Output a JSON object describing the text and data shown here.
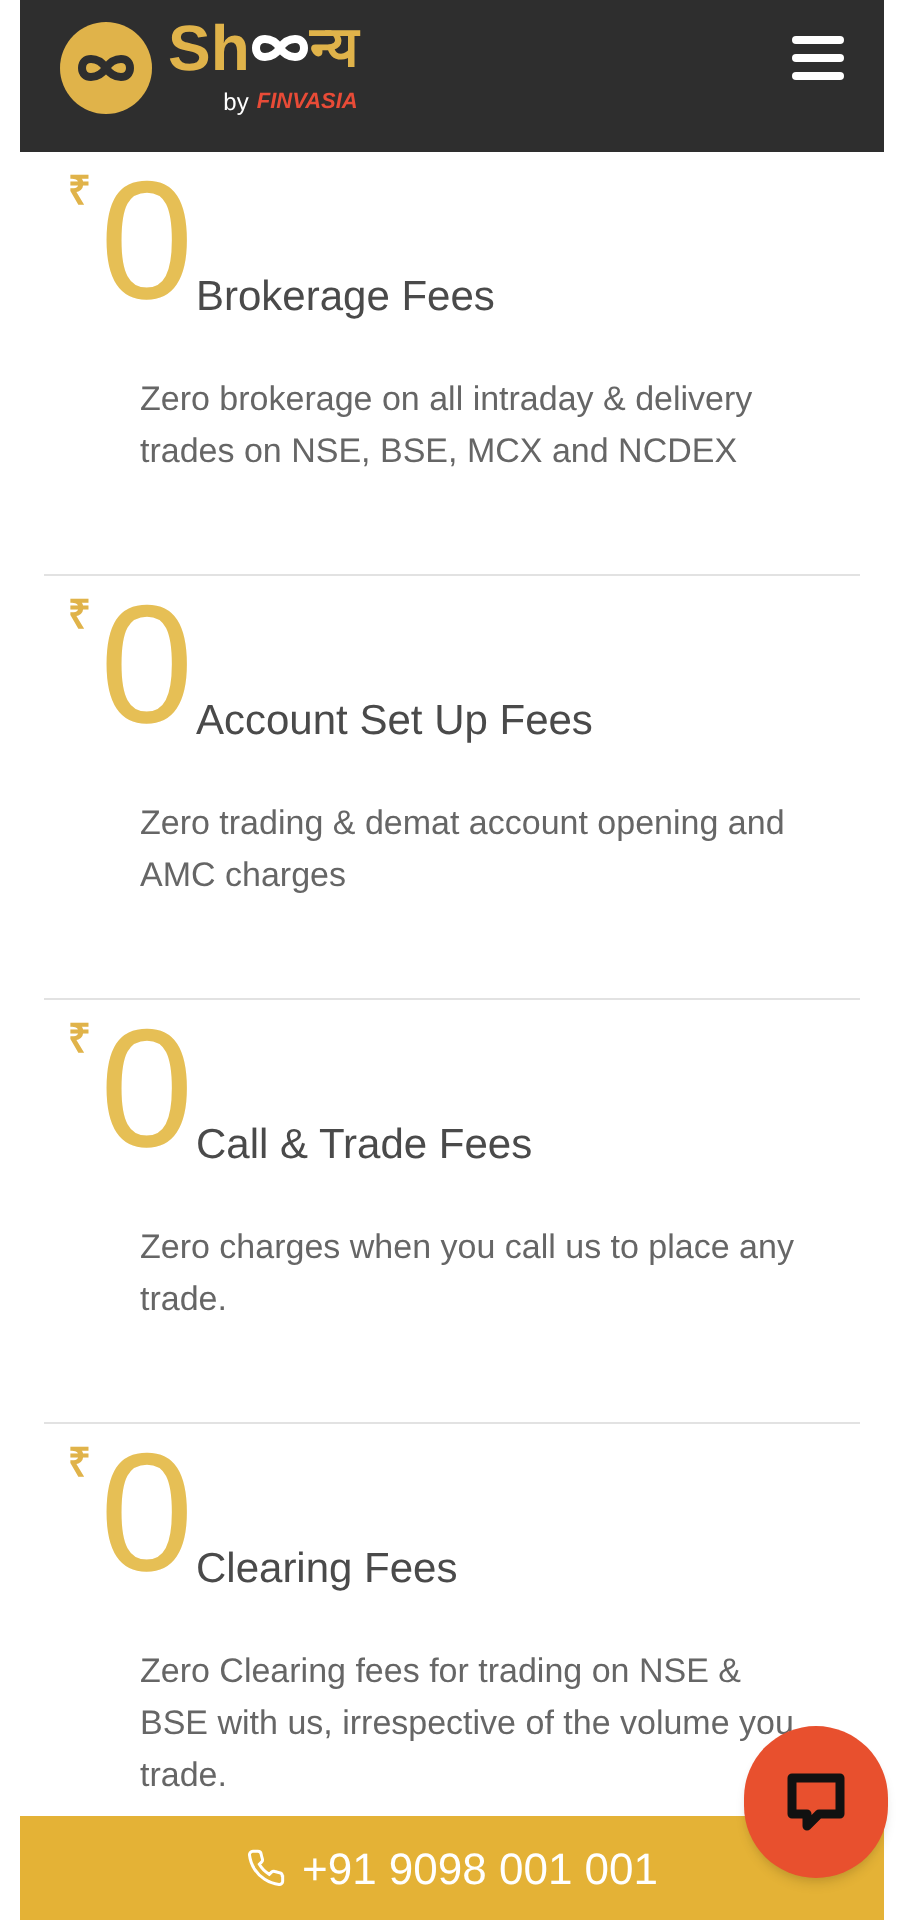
{
  "header": {
    "logo_text": "Sh",
    "logo_suffix": "न्य",
    "byline": "by",
    "brand": "FINVASIA"
  },
  "cards": [
    {
      "symbol": "₹",
      "amount": "0",
      "title": "Brokerage Fees",
      "description": "Zero brokerage on all intraday & delivery trades on NSE, BSE, MCX and NCDEX"
    },
    {
      "symbol": "₹",
      "amount": "0",
      "title": "Account Set Up Fees",
      "description": "Zero trading & demat account opening and AMC charges"
    },
    {
      "symbol": "₹",
      "amount": "0",
      "title": "Call & Trade Fees",
      "description": "Zero charges when you call us to place any trade."
    },
    {
      "symbol": "₹",
      "amount": "0",
      "title": "Clearing Fees",
      "description": "Zero Clearing fees for trading on NSE & BSE with us, irrespective of the volume you trade."
    }
  ],
  "call_bar": {
    "phone": "+91 9098 001 001"
  }
}
